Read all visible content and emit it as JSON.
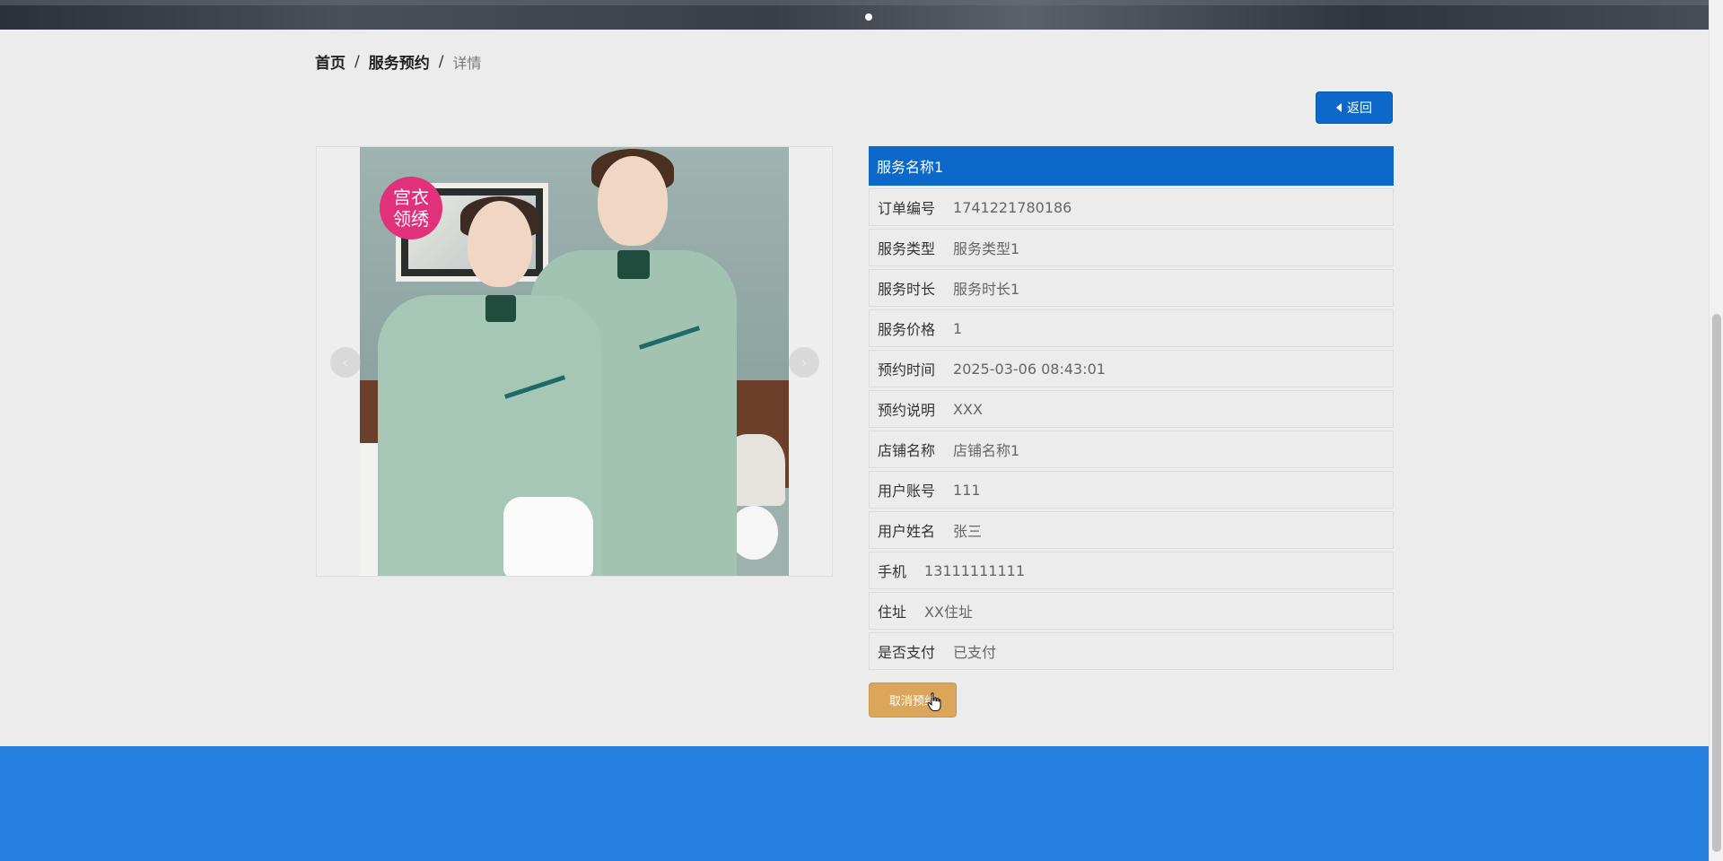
{
  "banner": {
    "carousel_dots": 1
  },
  "breadcrumb": {
    "items": [
      "首页",
      "服务预约"
    ],
    "separator": "/",
    "current": "详情"
  },
  "back_button": {
    "label": "返回",
    "icon": "caret-left-icon"
  },
  "gallery": {
    "badge_line1": "宫衣",
    "badge_line2": "领绣",
    "prev_icon": "chevron-left-icon",
    "next_icon": "chevron-right-icon",
    "prev_glyph": "‹",
    "next_glyph": "›"
  },
  "detail": {
    "title": "服务名称1",
    "rows": [
      {
        "label": "订单编号",
        "value": "1741221780186"
      },
      {
        "label": "服务类型",
        "value": "服务类型1"
      },
      {
        "label": "服务时长",
        "value": "服务时长1"
      },
      {
        "label": "服务价格",
        "value": "1"
      },
      {
        "label": "预约时间",
        "value": "2025-03-06 08:43:01"
      },
      {
        "label": "预约说明",
        "value": "XXX"
      },
      {
        "label": "店铺名称",
        "value": "店铺名称1"
      },
      {
        "label": "用户账号",
        "value": "111"
      },
      {
        "label": "用户姓名",
        "value": "张三"
      },
      {
        "label": "手机",
        "value": "13111111111"
      },
      {
        "label": "住址",
        "value": "XX住址"
      },
      {
        "label": "是否支付",
        "value": "已支付"
      }
    ]
  },
  "cancel_button": {
    "label": "取消预约"
  },
  "colors": {
    "primary": "#0c68c9",
    "footer": "#2680e0",
    "cancel": "#dba65a",
    "page_bg": "#ececec"
  }
}
